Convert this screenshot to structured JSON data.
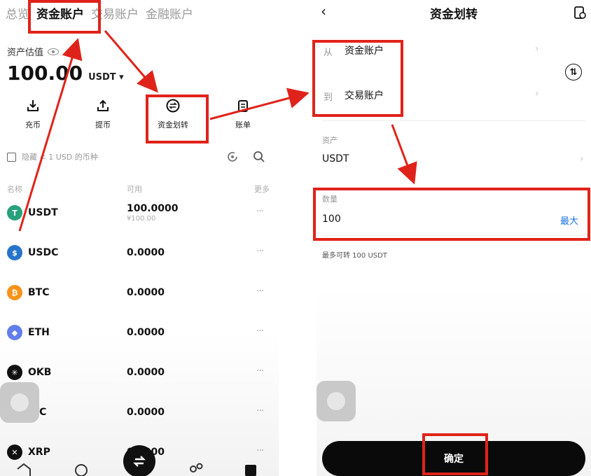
{
  "colors": {
    "highlight": "#e0231a",
    "max_link": "#1a73e8",
    "confirm_bg": "#0a0a0a"
  },
  "account_screen": {
    "tabs": [
      {
        "label": "总览",
        "active": false
      },
      {
        "label": "资金账户",
        "active": true
      },
      {
        "label": "交易账户",
        "active": false
      },
      {
        "label": "金融账户",
        "active": false
      }
    ],
    "valuation_label": "资产估值",
    "balance": "100.00",
    "balance_unit": "USDT ▾",
    "actions": [
      {
        "label": "充币",
        "icon": "deposit-icon"
      },
      {
        "label": "提币",
        "icon": "withdraw-icon"
      },
      {
        "label": "资金划转",
        "icon": "transfer-icon"
      },
      {
        "label": "账单",
        "icon": "bill-icon"
      }
    ],
    "hide_small_label": "隐藏 < 1 USD 的币种",
    "columns": {
      "name": "名称",
      "available": "可用",
      "more": "更多"
    },
    "assets": [
      {
        "symbol": "USDT",
        "amount": "100.0000",
        "sub": "¥100.00",
        "icon_color": "#26a17b",
        "glyph": "T"
      },
      {
        "symbol": "USDC",
        "amount": "0.0000",
        "sub": "",
        "icon_color": "#2775ca",
        "glyph": "$"
      },
      {
        "symbol": "BTC",
        "amount": "0.0000",
        "sub": "",
        "icon_color": "#f7931a",
        "glyph": "₿"
      },
      {
        "symbol": "ETH",
        "amount": "0.0000",
        "sub": "",
        "icon_color": "#627eea",
        "glyph": "◆"
      },
      {
        "symbol": "OKB",
        "amount": "0.0000",
        "sub": "",
        "icon_color": "#111111",
        "glyph": "✳"
      },
      {
        "symbol": "LTC",
        "amount": "0.0000",
        "sub": "",
        "icon_color": "#345d9d",
        "glyph": "Ł"
      },
      {
        "symbol": "XRP",
        "amount": "0.0000",
        "sub": "",
        "icon_color": "#111111",
        "glyph": "✕"
      }
    ],
    "more_dots": "···"
  },
  "transfer_screen": {
    "title": "资金划转",
    "back": "‹",
    "from_label": "从",
    "from_value": "资金账户",
    "to_label": "到",
    "to_value": "交易账户",
    "asset_label": "资产",
    "asset_value": "USDT",
    "amount_label": "数量",
    "amount_value": "100",
    "max_label": "最大",
    "max_transfer_hint": "最多可转 100 USDT",
    "confirm_label": "确定",
    "chevron": "›"
  }
}
